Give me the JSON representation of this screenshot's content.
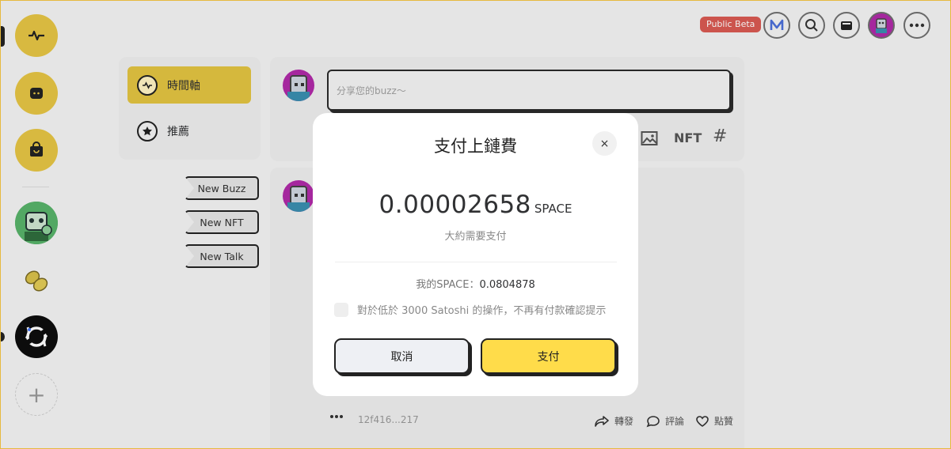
{
  "header": {
    "beta_badge": "Public Beta"
  },
  "nav": {
    "items": [
      {
        "label": "時間軸",
        "icon": "pulse-icon",
        "active": true
      },
      {
        "label": "推薦",
        "icon": "star-icon",
        "active": false
      }
    ],
    "quick_buttons": [
      "New Buzz",
      "New NFT",
      "New Talk"
    ]
  },
  "compose": {
    "placeholder": "分享您的buzz～",
    "tools": [
      "image-icon",
      "NFT",
      "#"
    ]
  },
  "post": {
    "tx_id": "12f416...217",
    "actions": [
      "轉發",
      "評論",
      "點贊"
    ]
  },
  "modal": {
    "title": "支付上鏈費",
    "close": "×",
    "amount": "0.00002658",
    "unit": "SPACE",
    "approx_label": "大約需要支付",
    "balance_label": "我的SPACE：",
    "balance_value": "0.0804878",
    "checkbox_label": "對於低於 3000 Satoshi 的操作，不再有付款確認提示",
    "cancel_label": "取消",
    "pay_label": "支付"
  },
  "colors": {
    "accent_yellow": "#ffdc4a",
    "beta_red": "#d95a52"
  }
}
